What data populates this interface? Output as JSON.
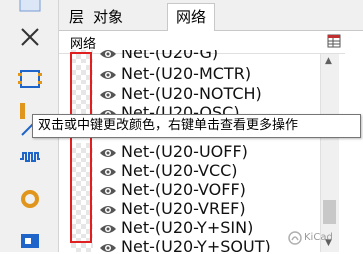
{
  "tabs": [
    {
      "label": "层",
      "active": false
    },
    {
      "label": "对象",
      "active": false
    },
    {
      "label": "网络",
      "active": true
    }
  ],
  "panel": {
    "title": "网络",
    "header_icon": "net-color-table-icon"
  },
  "nets": [
    "Net-(U20-G)",
    "Net-(U20-MCTR)",
    "Net-(U20-NOTCH)",
    "Net-(U20-OSC)",
    "Net-(U20-UOFF)",
    "Net-(U20-VCC)",
    "Net-(U20-VOFF)",
    "Net-(U20-VREF)",
    "Net-(U20-Y+SIN)",
    "Net-(U20-Y+SOUT)"
  ],
  "tooltip": "双击或中键更改颜色，右键单击查看更多操作",
  "toolbar_icons": [
    "select-arrow-icon",
    "no-connect-x-icon",
    "footprint-icon",
    "route-track-icon",
    "route-diff-pair-icon",
    "tune-length-icon",
    "via-icon",
    "zone-icon"
  ],
  "watermark": "KiCad",
  "colors": {
    "highlight": "#e02020",
    "accent": "#1f64c8"
  }
}
